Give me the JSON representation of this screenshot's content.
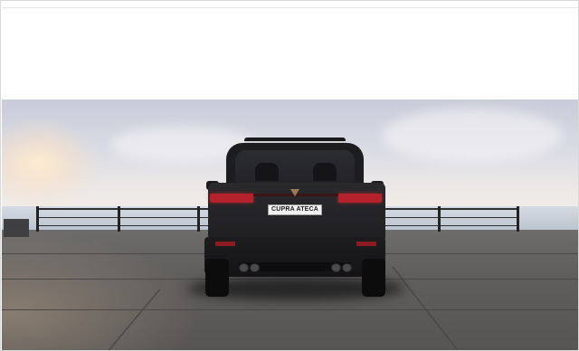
{
  "photo": {
    "subject": "vehicle-rear",
    "license_plate_text": "CUPRA ATECA"
  },
  "colors": {
    "car_body": "#1f1f22",
    "taillight": "#b4232c",
    "sky": "#d9dbe4",
    "deck": "#615f5d"
  }
}
